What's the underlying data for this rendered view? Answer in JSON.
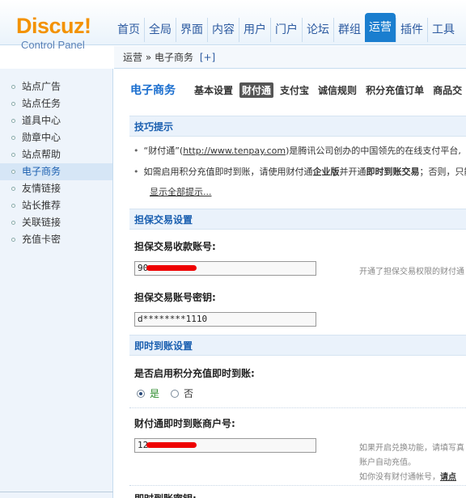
{
  "logo": {
    "brand": "Discuz!",
    "subtitle": "Control Panel"
  },
  "topnav": [
    "首页",
    "全局",
    "界面",
    "内容",
    "用户",
    "门户",
    "论坛",
    "群组",
    "运营",
    "插件",
    "工具"
  ],
  "topnav_active": "运营",
  "breadcrumb": {
    "path": "运营 » 电子商务",
    "plus": "[+]"
  },
  "sidebar": {
    "items": [
      "站点广告",
      "站点任务",
      "道具中心",
      "勋章中心",
      "站点帮助",
      "电子商务",
      "友情链接",
      "站长推荐",
      "关联链接",
      "充值卡密"
    ],
    "active": "电子商务"
  },
  "subnav": {
    "title": "电子商务",
    "tabs": [
      "基本设置",
      "财付通",
      "支付宝",
      "诚信规则",
      "积分充值订单",
      "商品交"
    ],
    "active": "财付通"
  },
  "sections": {
    "tips_title": "技巧提示",
    "tip1_pre": "“财付通”(",
    "tip1_link": "http://www.tenpay.com",
    "tip1_post": ")是腾讯公司创办的中国领先的在线支付平台,",
    "tip2_a": "如需启用积分充值即时到账，请使用财付通",
    "tip2_b": "企业版",
    "tip2_c": "并开通",
    "tip2_d": "即时到账交易",
    "tip2_e": "；否则，只能",
    "show_all": "显示全部提示...",
    "escrow_title": "担保交易设置",
    "escrow_account_label": "担保交易收款账号:",
    "escrow_account_value": "90",
    "escrow_account_hint": "开通了担保交易权限的财付通",
    "escrow_key_label": "担保交易账号密钥:",
    "escrow_key_value": "d********1110",
    "instant_title": "即时到账设置",
    "instant_enable_label": "是否启用积分充值即时到账:",
    "radio_yes": "是",
    "radio_no": "否",
    "merchant_label": "财付通即时到账商户号:",
    "merchant_value": "12",
    "merchant_hint1": "如果开启兑换功能，请填写真",
    "merchant_hint2": "账户自动充值。",
    "merchant_hint3_pre": "如你没有财付通帐号，",
    "merchant_hint3_link": "请点",
    "cut_label": "即时到账密钥:"
  },
  "colors": {
    "accent": "#1a7ecf",
    "brand": "#f39200",
    "section_bg": "#eaf2fb"
  }
}
